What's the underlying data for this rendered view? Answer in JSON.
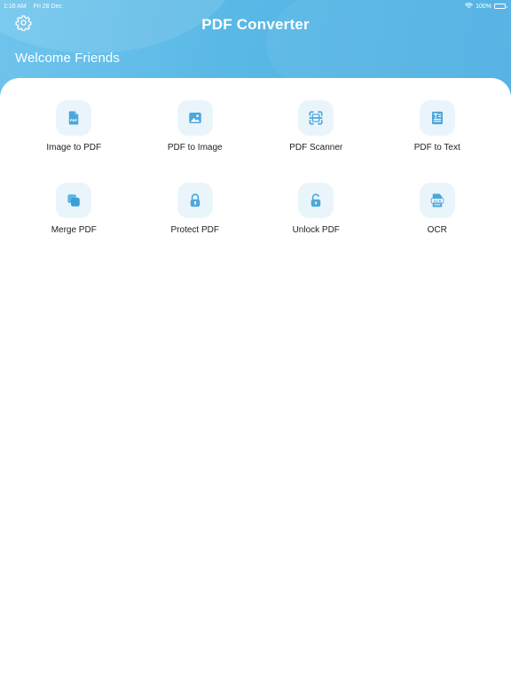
{
  "status_bar": {
    "time": "1:16 AM",
    "date": "Fri 28 Dec",
    "battery": "100%",
    "wifi_icon": "wifi-icon",
    "battery_icon": "battery-icon"
  },
  "header": {
    "title": "PDF Converter",
    "welcome": "Welcome Friends",
    "settings_icon": "gear-icon"
  },
  "colors": {
    "header_gradient_start": "#6fc4ec",
    "header_gradient_end": "#4cafe2",
    "icon_accent": "#4aa8dc",
    "icon_background": "#eaf5fb",
    "label_text": "#222222"
  },
  "tools": [
    {
      "label": "Image to PDF",
      "icon": "pdf-file-icon"
    },
    {
      "label": "PDF to Image",
      "icon": "image-icon"
    },
    {
      "label": "PDF Scanner",
      "icon": "scanner-icon"
    },
    {
      "label": "PDF to Text",
      "icon": "text-document-icon"
    },
    {
      "label": "Merge PDF",
      "icon": "merge-icon"
    },
    {
      "label": "Protect PDF",
      "icon": "lock-icon"
    },
    {
      "label": "Unlock PDF",
      "icon": "unlock-icon"
    },
    {
      "label": "OCR",
      "icon": "ocr-icon"
    }
  ]
}
